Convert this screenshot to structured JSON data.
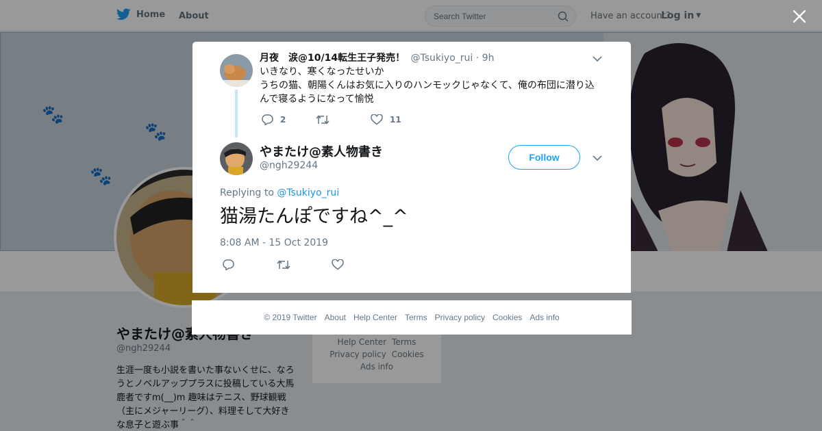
{
  "nav": {
    "home_label": "Home",
    "about_label": "About",
    "search_placeholder": "Search Twitter",
    "have_account": "Have an account?",
    "login_label": "Log in"
  },
  "profile": {
    "name": "やまたけ@素人物書き",
    "handle": "@ngh29244",
    "bio": "生涯一度も小説を書いた事ないくせに、なろうとノベルアッププラスに投稿している大馬鹿者ですm(__)m 趣味はテニス、野球観戦（主にメジャーリーグ）、料理そして大好きな息子と遊ぶ事＾＾"
  },
  "side_footer": {
    "links": [
      "Help Center",
      "Terms",
      "Privacy policy",
      "Cookies",
      "Ads info"
    ]
  },
  "parent_tweet": {
    "name": "月夜　涙@10/14転生王子発売！",
    "handle": "@Tsukiyo_rui",
    "time": "· 9h",
    "text_lines": [
      "いきなり、寒くなったせいか",
      "うちの猫、朝陽くんはお気に入りのハンモックじゃなくて、俺の布団に潜り込",
      "んで寝るようになって愉悦"
    ],
    "reply_count": "2",
    "like_count": "11"
  },
  "main_tweet": {
    "name": "やまたけ@素人物書き",
    "handle": "@ngh29244",
    "follow_label": "Follow",
    "replying_prefix": "Replying to",
    "replying_handle": "@Tsukiyo_rui",
    "text": "猫湯たんぽですね^_^",
    "timestamp": "8:08 AM - 15 Oct 2019"
  },
  "modal_footer": {
    "links": [
      "© 2019 Twitter",
      "About",
      "Help Center",
      "Terms",
      "Privacy policy",
      "Cookies",
      "Ads info"
    ]
  },
  "colors": {
    "twitter_blue": "#1da1f2",
    "link_blue": "#1b95e0",
    "secondary_text": "#657786",
    "thread_line": "#c4e4f7"
  }
}
